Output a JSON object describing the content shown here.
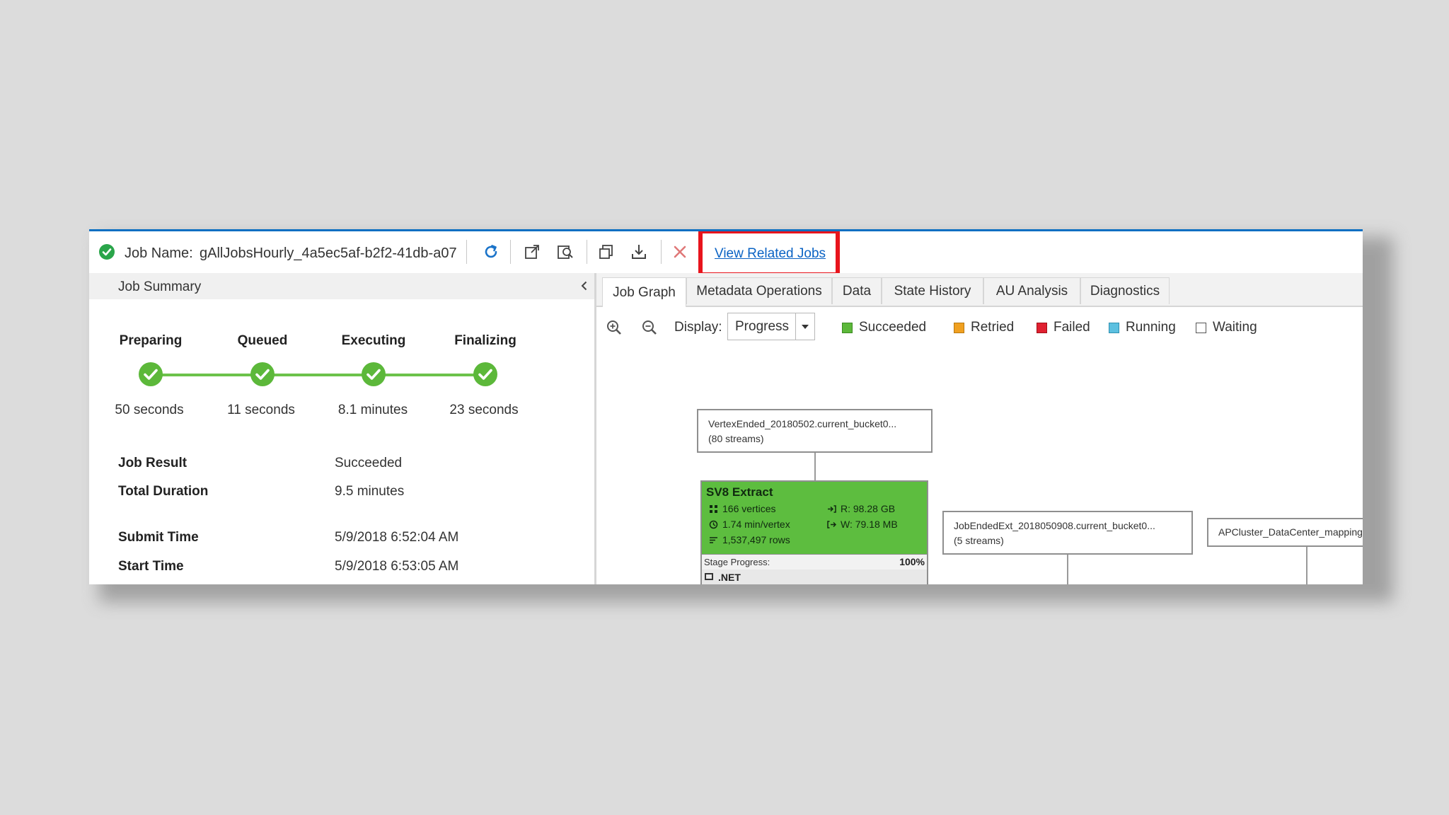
{
  "toolbar": {
    "job_name_label": "Job Name:",
    "job_name_value": "gAllJobsHourly_4a5ec5af-b2f2-41db-a07",
    "icons": [
      "refresh-icon",
      "open-external-icon",
      "search-preview-icon",
      "copy-script-icon",
      "download-icon",
      "cancel-icon"
    ],
    "view_related_jobs": "View Related Jobs",
    "highlight_color": "#e8141c"
  },
  "summary": {
    "title": "Job Summary",
    "stages": [
      {
        "label": "Preparing",
        "time": "50 seconds"
      },
      {
        "label": "Queued",
        "time": "11 seconds"
      },
      {
        "label": "Executing",
        "time": "8.1 minutes"
      },
      {
        "label": "Finalizing",
        "time": "23 seconds"
      }
    ],
    "fields": [
      {
        "key": "Job Result",
        "value": "Succeeded"
      },
      {
        "key": "Total Duration",
        "value": "9.5 minutes"
      },
      {
        "key": "Submit Time",
        "value": "5/9/2018 6:52:04 AM"
      },
      {
        "key": "Start Time",
        "value": "5/9/2018 6:53:05 AM"
      }
    ]
  },
  "tabs": [
    {
      "label": "Job Graph",
      "active": true
    },
    {
      "label": "Metadata Operations",
      "active": false
    },
    {
      "label": "Data",
      "active": false
    },
    {
      "label": "State History",
      "active": false
    },
    {
      "label": "AU Analysis",
      "active": false
    },
    {
      "label": "Diagnostics",
      "active": false
    }
  ],
  "graph_toolbar": {
    "display_label": "Display:",
    "display_value": "Progress",
    "legend": [
      {
        "label": "Succeeded",
        "color": "#5cb83a"
      },
      {
        "label": "Retried",
        "color": "#f0a020"
      },
      {
        "label": "Failed",
        "color": "#e02030"
      },
      {
        "label": "Running",
        "color": "#5cc0e0"
      },
      {
        "label": "Waiting",
        "color": "#ffffff"
      }
    ]
  },
  "graph": {
    "input_node": {
      "name": "VertexEnded_20180502.current_bucket0...",
      "streams": "(80 streams)"
    },
    "stage": {
      "title": "SV8 Extract",
      "vertices": "166 vertices",
      "time_per_vertex": "1.74 min/vertex",
      "rows": "1,537,497 rows",
      "read": "R: 98.28 GB",
      "write": "W: 79.18 MB",
      "progress_label": "Stage Progress:",
      "progress_value": "100%",
      "runtime": ".NET",
      "color": "#5dbd3f"
    },
    "output_node_1": {
      "name": "JobEndedExt_2018050908.current_bucket0...",
      "streams": "(5 streams)"
    },
    "output_node_2": {
      "name": "APCluster_DataCenter_mapping.tsv"
    }
  }
}
